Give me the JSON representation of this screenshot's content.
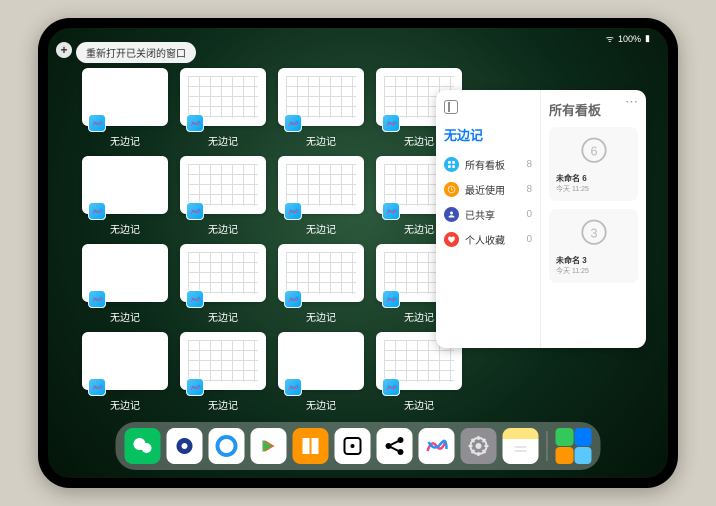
{
  "status": {
    "battery": "100%"
  },
  "reopen": {
    "label": "重新打开已关闭的窗口"
  },
  "windows": {
    "label": "无边记",
    "rows": [
      [
        "blank",
        "grid",
        "grid",
        "grid"
      ],
      [
        "blank",
        "grid",
        "grid",
        "grid"
      ],
      [
        "blank",
        "grid",
        "grid",
        "grid"
      ],
      [
        "blank",
        "grid",
        "blank",
        "grid"
      ]
    ]
  },
  "panel": {
    "left_title": "无边记",
    "right_title": "所有看板",
    "items": [
      {
        "icon": "grid",
        "label": "所有看板",
        "count": "8"
      },
      {
        "icon": "clock",
        "label": "最近使用",
        "count": "8"
      },
      {
        "icon": "people",
        "label": "已共享",
        "count": "0"
      },
      {
        "icon": "heart",
        "label": "个人收藏",
        "count": "0"
      }
    ],
    "cards": [
      {
        "num": "6",
        "title": "未命名 6",
        "sub": "今天 11:25"
      },
      {
        "num": "3",
        "title": "未命名 3",
        "sub": "今天 11:25"
      }
    ]
  },
  "dock": {
    "apps": [
      "wechat",
      "quark",
      "qq-browser",
      "youku",
      "books",
      "dice",
      "share",
      "freeform",
      "settings",
      "notes"
    ]
  }
}
